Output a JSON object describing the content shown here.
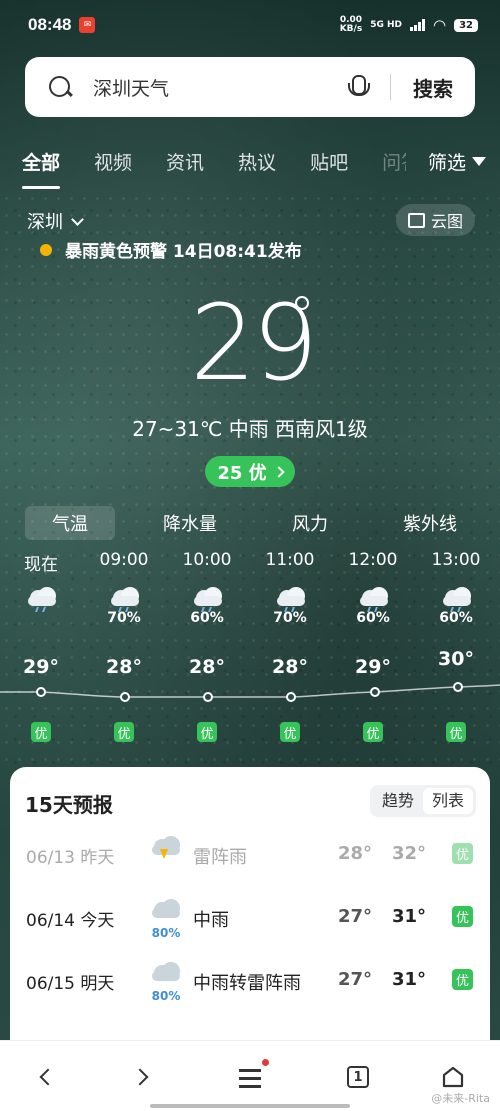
{
  "status_bar": {
    "time": "08:48",
    "net_speed": "0.00",
    "net_unit": "KB/s",
    "network_type": "5G HD",
    "battery": "32"
  },
  "search": {
    "query": "深圳天气",
    "button": "搜索"
  },
  "tabs": {
    "items": [
      "全部",
      "视频",
      "资讯",
      "热议",
      "贴吧"
    ],
    "cut_item": "问答",
    "filter": "筛选"
  },
  "weather": {
    "city": "深圳",
    "cloud_map": "云图",
    "alert": "暴雨黄色预警 14日08:41发布",
    "current_temp": "29",
    "summary": "27~31℃ 中雨 西南风1级",
    "aqi": "25 优"
  },
  "subtabs": [
    "气温",
    "降水量",
    "风力",
    "紫外线"
  ],
  "hourly": [
    {
      "time": "现在",
      "icon": "rain-cloud-icon",
      "pop": "",
      "temp": "29°",
      "aqi": "优"
    },
    {
      "time": "09:00",
      "icon": "rain-cloud-icon",
      "pop": "70%",
      "temp": "28°",
      "aqi": "优"
    },
    {
      "time": "10:00",
      "icon": "rain-cloud-icon",
      "pop": "60%",
      "temp": "28°",
      "aqi": "优"
    },
    {
      "time": "11:00",
      "icon": "rain-cloud-icon",
      "pop": "70%",
      "temp": "28°",
      "aqi": "优"
    },
    {
      "time": "12:00",
      "icon": "rain-cloud-icon",
      "pop": "60%",
      "temp": "29°",
      "aqi": "优"
    },
    {
      "time": "13:00",
      "icon": "rain-cloud-icon",
      "pop": "60%",
      "temp": "30°",
      "aqi": "优"
    }
  ],
  "forecast": {
    "title": "15天预报",
    "toggle": [
      "趋势",
      "列表"
    ],
    "days": [
      {
        "date": "06/13 昨天",
        "pop": "",
        "desc": "雷阵雨",
        "lo": "28°",
        "hi": "32°",
        "aqi": "优"
      },
      {
        "date": "06/14 今天",
        "pop": "80%",
        "desc": "中雨",
        "lo": "27°",
        "hi": "31°",
        "aqi": "优"
      },
      {
        "date": "06/15 明天",
        "pop": "80%",
        "desc": "中雨转雷阵雨",
        "lo": "27°",
        "hi": "31°",
        "aqi": "优"
      }
    ]
  },
  "nav": {
    "tab_count": "1"
  },
  "watermark": "@未来-Rita"
}
